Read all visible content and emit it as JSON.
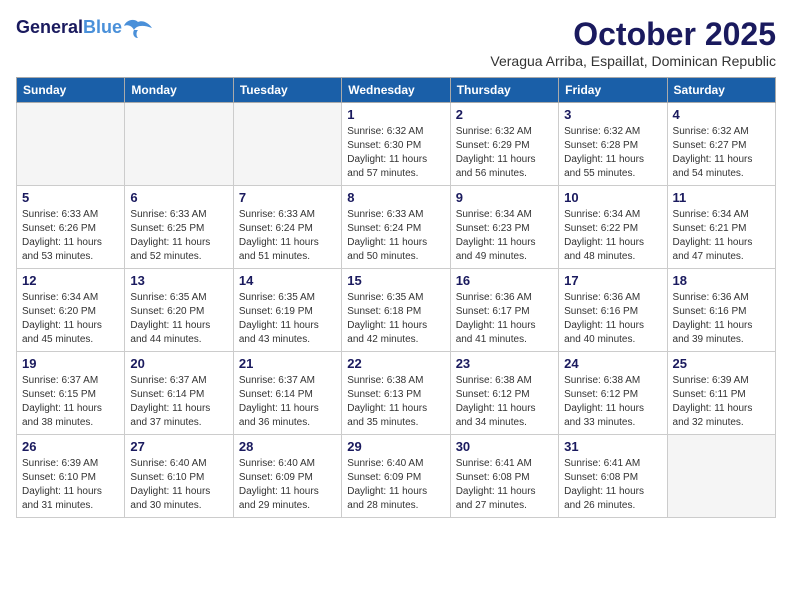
{
  "logo": {
    "line1": "General",
    "line2": "Blue"
  },
  "title": "October 2025",
  "subtitle": "Veragua Arriba, Espaillat, Dominican Republic",
  "weekdays": [
    "Sunday",
    "Monday",
    "Tuesday",
    "Wednesday",
    "Thursday",
    "Friday",
    "Saturday"
  ],
  "weeks": [
    [
      {
        "day": "",
        "info": ""
      },
      {
        "day": "",
        "info": ""
      },
      {
        "day": "",
        "info": ""
      },
      {
        "day": "1",
        "info": "Sunrise: 6:32 AM\nSunset: 6:30 PM\nDaylight: 11 hours and 57 minutes."
      },
      {
        "day": "2",
        "info": "Sunrise: 6:32 AM\nSunset: 6:29 PM\nDaylight: 11 hours and 56 minutes."
      },
      {
        "day": "3",
        "info": "Sunrise: 6:32 AM\nSunset: 6:28 PM\nDaylight: 11 hours and 55 minutes."
      },
      {
        "day": "4",
        "info": "Sunrise: 6:32 AM\nSunset: 6:27 PM\nDaylight: 11 hours and 54 minutes."
      }
    ],
    [
      {
        "day": "5",
        "info": "Sunrise: 6:33 AM\nSunset: 6:26 PM\nDaylight: 11 hours and 53 minutes."
      },
      {
        "day": "6",
        "info": "Sunrise: 6:33 AM\nSunset: 6:25 PM\nDaylight: 11 hours and 52 minutes."
      },
      {
        "day": "7",
        "info": "Sunrise: 6:33 AM\nSunset: 6:24 PM\nDaylight: 11 hours and 51 minutes."
      },
      {
        "day": "8",
        "info": "Sunrise: 6:33 AM\nSunset: 6:24 PM\nDaylight: 11 hours and 50 minutes."
      },
      {
        "day": "9",
        "info": "Sunrise: 6:34 AM\nSunset: 6:23 PM\nDaylight: 11 hours and 49 minutes."
      },
      {
        "day": "10",
        "info": "Sunrise: 6:34 AM\nSunset: 6:22 PM\nDaylight: 11 hours and 48 minutes."
      },
      {
        "day": "11",
        "info": "Sunrise: 6:34 AM\nSunset: 6:21 PM\nDaylight: 11 hours and 47 minutes."
      }
    ],
    [
      {
        "day": "12",
        "info": "Sunrise: 6:34 AM\nSunset: 6:20 PM\nDaylight: 11 hours and 45 minutes."
      },
      {
        "day": "13",
        "info": "Sunrise: 6:35 AM\nSunset: 6:20 PM\nDaylight: 11 hours and 44 minutes."
      },
      {
        "day": "14",
        "info": "Sunrise: 6:35 AM\nSunset: 6:19 PM\nDaylight: 11 hours and 43 minutes."
      },
      {
        "day": "15",
        "info": "Sunrise: 6:35 AM\nSunset: 6:18 PM\nDaylight: 11 hours and 42 minutes."
      },
      {
        "day": "16",
        "info": "Sunrise: 6:36 AM\nSunset: 6:17 PM\nDaylight: 11 hours and 41 minutes."
      },
      {
        "day": "17",
        "info": "Sunrise: 6:36 AM\nSunset: 6:16 PM\nDaylight: 11 hours and 40 minutes."
      },
      {
        "day": "18",
        "info": "Sunrise: 6:36 AM\nSunset: 6:16 PM\nDaylight: 11 hours and 39 minutes."
      }
    ],
    [
      {
        "day": "19",
        "info": "Sunrise: 6:37 AM\nSunset: 6:15 PM\nDaylight: 11 hours and 38 minutes."
      },
      {
        "day": "20",
        "info": "Sunrise: 6:37 AM\nSunset: 6:14 PM\nDaylight: 11 hours and 37 minutes."
      },
      {
        "day": "21",
        "info": "Sunrise: 6:37 AM\nSunset: 6:14 PM\nDaylight: 11 hours and 36 minutes."
      },
      {
        "day": "22",
        "info": "Sunrise: 6:38 AM\nSunset: 6:13 PM\nDaylight: 11 hours and 35 minutes."
      },
      {
        "day": "23",
        "info": "Sunrise: 6:38 AM\nSunset: 6:12 PM\nDaylight: 11 hours and 34 minutes."
      },
      {
        "day": "24",
        "info": "Sunrise: 6:38 AM\nSunset: 6:12 PM\nDaylight: 11 hours and 33 minutes."
      },
      {
        "day": "25",
        "info": "Sunrise: 6:39 AM\nSunset: 6:11 PM\nDaylight: 11 hours and 32 minutes."
      }
    ],
    [
      {
        "day": "26",
        "info": "Sunrise: 6:39 AM\nSunset: 6:10 PM\nDaylight: 11 hours and 31 minutes."
      },
      {
        "day": "27",
        "info": "Sunrise: 6:40 AM\nSunset: 6:10 PM\nDaylight: 11 hours and 30 minutes."
      },
      {
        "day": "28",
        "info": "Sunrise: 6:40 AM\nSunset: 6:09 PM\nDaylight: 11 hours and 29 minutes."
      },
      {
        "day": "29",
        "info": "Sunrise: 6:40 AM\nSunset: 6:09 PM\nDaylight: 11 hours and 28 minutes."
      },
      {
        "day": "30",
        "info": "Sunrise: 6:41 AM\nSunset: 6:08 PM\nDaylight: 11 hours and 27 minutes."
      },
      {
        "day": "31",
        "info": "Sunrise: 6:41 AM\nSunset: 6:08 PM\nDaylight: 11 hours and 26 minutes."
      },
      {
        "day": "",
        "info": ""
      }
    ]
  ]
}
